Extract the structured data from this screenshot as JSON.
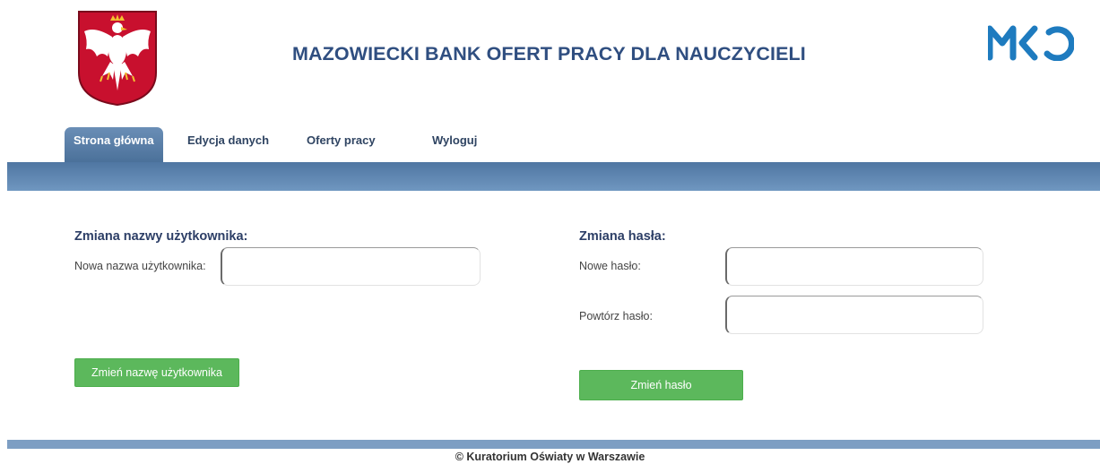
{
  "header": {
    "title": "MAZOWIECKI BANK OFERT PRACY DLA NAUCZYCIELI",
    "emblem_icon": "polish-eagle-emblem-icon",
    "logo_icon": "mko-logo-icon",
    "logo_text": "MKO",
    "accent_color": "#2f4e80",
    "logo_color": "#1e7bbf"
  },
  "nav": {
    "tabs": [
      {
        "label": "Strona główna",
        "active": true
      },
      {
        "label": "Edycja danych",
        "active": false
      },
      {
        "label": "Oferty pracy",
        "active": false
      },
      {
        "label": "Wyloguj",
        "active": false
      }
    ],
    "bar_color": "#5a82ae"
  },
  "username_form": {
    "title": "Zmiana nazwy użytkownika:",
    "new_username_label": "Nowa nazwa użytkownika:",
    "new_username_value": "",
    "submit_label": "Zmień nazwę użytkownika"
  },
  "password_form": {
    "title": "Zmiana hasła:",
    "new_password_label": "Nowe hasło:",
    "new_password_value": "",
    "repeat_password_label": "Powtórz hasło:",
    "repeat_password_value": "",
    "submit_label": "Zmień hasło"
  },
  "buttons": {
    "color": "#5cb85c"
  },
  "footer": {
    "text": "© Kuratorium Oświaty w Warszawie"
  }
}
